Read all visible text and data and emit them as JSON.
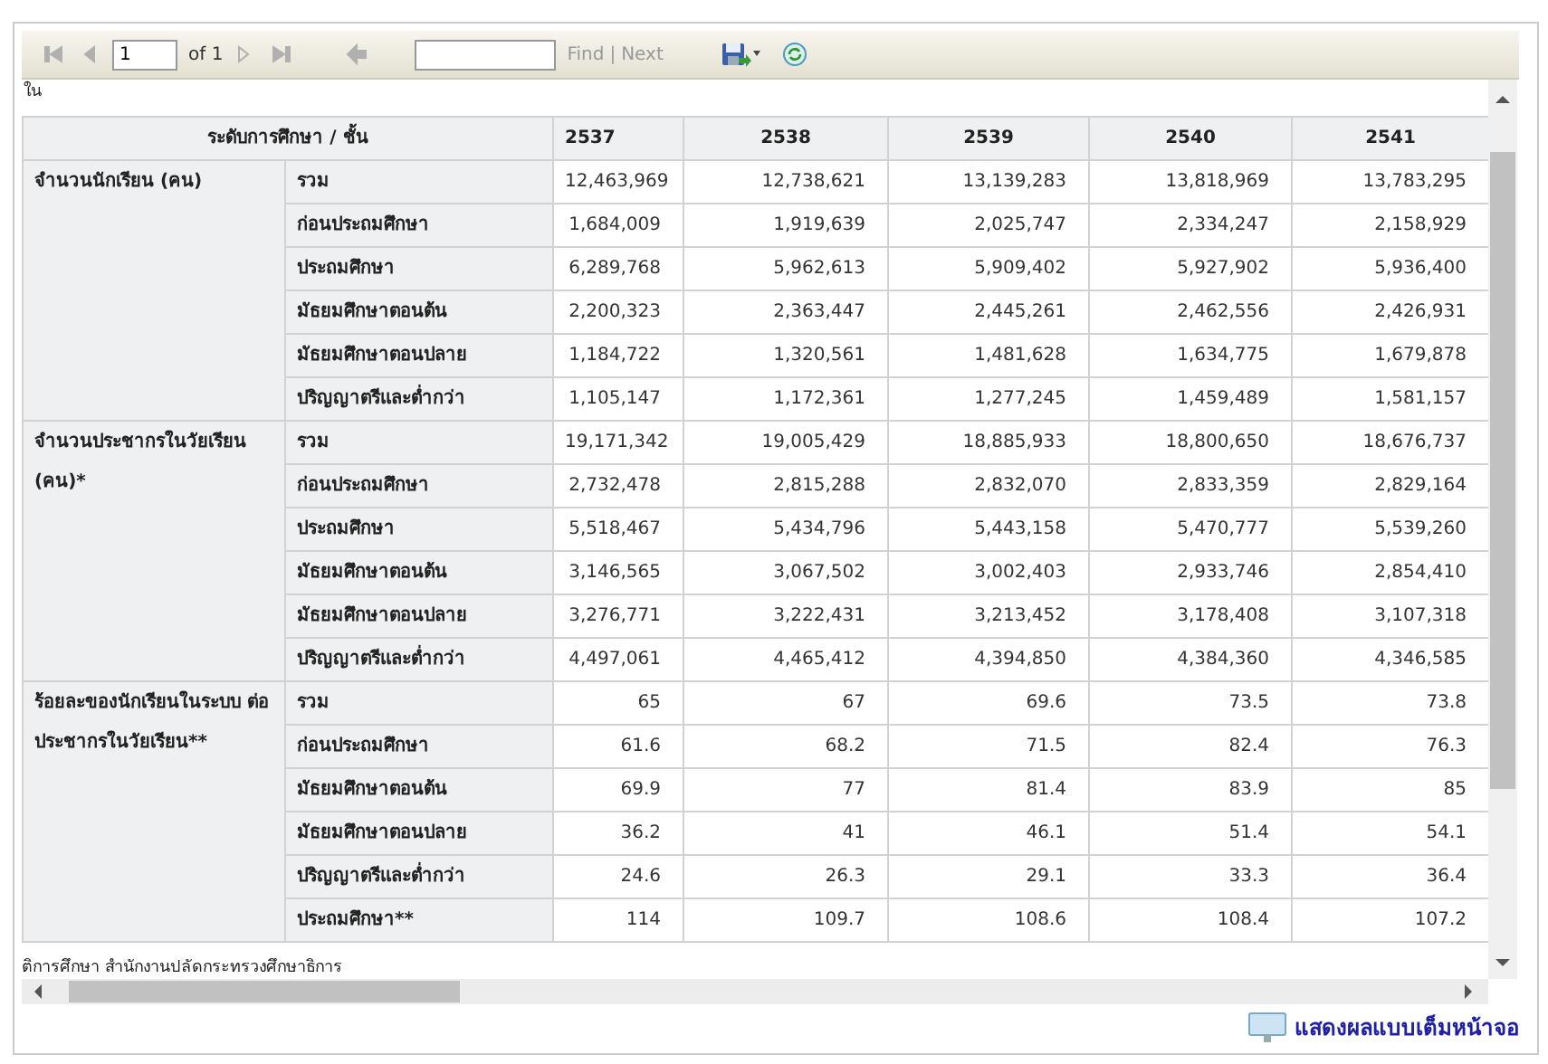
{
  "toolbar": {
    "nav_buttons": [
      {
        "kind": "first",
        "disabled": true
      },
      {
        "kind": "prev",
        "disabled": true
      },
      {
        "kind": "page"
      },
      {
        "kind": "next",
        "disabled": true
      },
      {
        "kind": "last",
        "disabled": true
      },
      {
        "kind": "back",
        "disabled": true
      }
    ],
    "page_value": "1",
    "page_of": "of 1",
    "find": {
      "label": "Find",
      "disabled": true
    },
    "separator": "|",
    "next": {
      "label": "Next",
      "disabled": true
    }
  },
  "cut_text": "ใน",
  "table": {
    "header": [
      "ระดับการศึกษา / ชั้น",
      "2537",
      "2538",
      "2539",
      "2540",
      "2541"
    ],
    "groups": [
      {
        "label": "จำนวนนักเรียน (คน)",
        "rows": [
          {
            "level": "รวม",
            "values": [
              "12,463,969",
              "12,738,621",
              "13,139,283",
              "13,818,969",
              "13,783,295"
            ]
          },
          {
            "level": "ก่อนประถมศึกษา",
            "values": [
              "1,684,009",
              "1,919,639",
              "2,025,747",
              "2,334,247",
              "2,158,929"
            ]
          },
          {
            "level": "ประถมศึกษา",
            "values": [
              "6,289,768",
              "5,962,613",
              "5,909,402",
              "5,927,902",
              "5,936,400"
            ]
          },
          {
            "level": "มัธยมศึกษาตอนต้น",
            "values": [
              "2,200,323",
              "2,363,447",
              "2,445,261",
              "2,462,556",
              "2,426,931"
            ]
          },
          {
            "level": "มัธยมศึกษาตอนปลาย",
            "values": [
              "1,184,722",
              "1,320,561",
              "1,481,628",
              "1,634,775",
              "1,679,878"
            ]
          },
          {
            "level": "ปริญญาตรีและต่ำกว่า",
            "values": [
              "1,105,147",
              "1,172,361",
              "1,277,245",
              "1,459,489",
              "1,581,157"
            ]
          }
        ]
      },
      {
        "label": "จำนวนประชากรในวัยเรียน (คน)*",
        "rows": [
          {
            "level": "รวม",
            "values": [
              "19,171,342",
              "19,005,429",
              "18,885,933",
              "18,800,650",
              "18,676,737"
            ]
          },
          {
            "level": "ก่อนประถมศึกษา",
            "values": [
              "2,732,478",
              "2,815,288",
              "2,832,070",
              "2,833,359",
              "2,829,164"
            ]
          },
          {
            "level": "ประถมศึกษา",
            "values": [
              "5,518,467",
              "5,434,796",
              "5,443,158",
              "5,470,777",
              "5,539,260"
            ]
          },
          {
            "level": "มัธยมศึกษาตอนต้น",
            "values": [
              "3,146,565",
              "3,067,502",
              "3,002,403",
              "2,933,746",
              "2,854,410"
            ]
          },
          {
            "level": "มัธยมศึกษาตอนปลาย",
            "values": [
              "3,276,771",
              "3,222,431",
              "3,213,452",
              "3,178,408",
              "3,107,318"
            ]
          },
          {
            "level": "ปริญญาตรีและต่ำกว่า",
            "values": [
              "4,497,061",
              "4,465,412",
              "4,394,850",
              "4,384,360",
              "4,346,585"
            ]
          }
        ]
      },
      {
        "label": "ร้อยละของนักเรียนในระบบ ต่อประชากรในวัยเรียน**",
        "rows": [
          {
            "level": "รวม",
            "values": [
              "65",
              "67",
              "69.6",
              "73.5",
              "73.8"
            ]
          },
          {
            "level": "ก่อนประถมศึกษา",
            "values": [
              "61.6",
              "68.2",
              "71.5",
              "82.4",
              "76.3"
            ]
          },
          {
            "level": "มัธยมศึกษาตอนต้น",
            "values": [
              "69.9",
              "77",
              "81.4",
              "83.9",
              "85"
            ]
          },
          {
            "level": "มัธยมศึกษาตอนปลาย",
            "values": [
              "36.2",
              "41",
              "46.1",
              "51.4",
              "54.1"
            ]
          },
          {
            "level": "ปริญญาตรีและต่ำกว่า",
            "values": [
              "24.6",
              "26.3",
              "29.1",
              "33.3",
              "36.4"
            ]
          },
          {
            "level": "ประถมศึกษา**",
            "values": [
              "114",
              "109.7",
              "108.6",
              "108.4",
              "107.2"
            ]
          }
        ]
      }
    ]
  },
  "footer_note": "ติการศึกษา สำนักงานปลัดกระทรวงศึกษาธิการ",
  "fullscreen_link": "แสดงผลแบบเต็มหน้าจอ"
}
